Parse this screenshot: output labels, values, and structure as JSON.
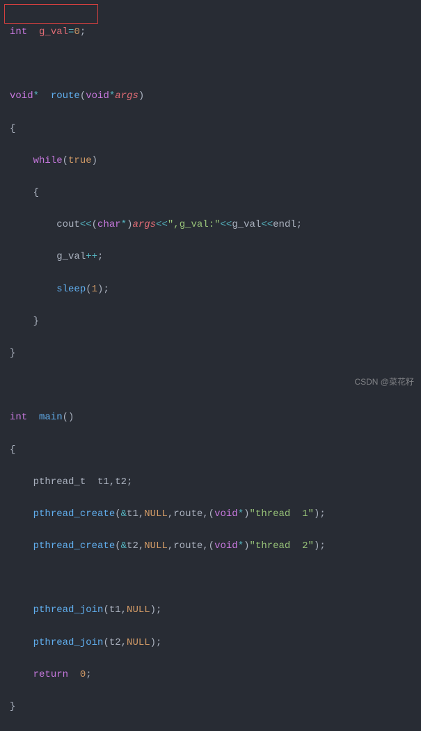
{
  "code": {
    "l1": {
      "t1": "int",
      "t2": "  g_val",
      "t3": "=",
      "t4": "0",
      "t5": ";"
    },
    "l3": {
      "t1": "void",
      "t2": "*",
      "t3": "  ",
      "t4": "route",
      "t5": "(",
      "t6": "void",
      "t7": "*",
      "t8": "args",
      "t9": ")"
    },
    "l4": {
      "t1": "{"
    },
    "l5": {
      "t1": "    ",
      "t2": "while",
      "t3": "(",
      "t4": "true",
      "t5": ")"
    },
    "l6": {
      "t1": "    {"
    },
    "l7": {
      "t1": "        cout",
      "t2": "<<",
      "t3": "(",
      "t4": "char",
      "t5": "*",
      "t6": ")",
      "t7": "args",
      "t8": "<<",
      "t9": "\",g_val:\"",
      "t10": "<<",
      "t11": "g_val",
      "t12": "<<",
      "t13": "endl;"
    },
    "l8": {
      "t1": "        g_val",
      "t2": "++",
      "t3": ";"
    },
    "l9": {
      "t1": "        ",
      "t2": "sleep",
      "t3": "(",
      "t4": "1",
      "t5": ");"
    },
    "l10": {
      "t1": "    }"
    },
    "l11": {
      "t1": "}"
    },
    "l13": {
      "t1": "int",
      "t2": "  ",
      "t3": "main",
      "t4": "()"
    },
    "l14": {
      "t1": "{"
    },
    "l15": {
      "t1": "    pthread_t  t1,t2;"
    },
    "l16": {
      "t1": "    ",
      "t2": "pthread_create",
      "t3": "(",
      "t4": "&",
      "t5": "t1,",
      "t6": "NULL",
      "t7": ",route,(",
      "t8": "void",
      "t9": "*",
      "t10": ")",
      "t11": "\"thread  1\"",
      "t12": ");"
    },
    "l17": {
      "t1": "    ",
      "t2": "pthread_create",
      "t3": "(",
      "t4": "&",
      "t5": "t2,",
      "t6": "NULL",
      "t7": ",route,(",
      "t8": "void",
      "t9": "*",
      "t10": ")",
      "t11": "\"thread  2\"",
      "t12": ");"
    },
    "l19": {
      "t1": "    ",
      "t2": "pthread_join",
      "t3": "(t1,",
      "t4": "NULL",
      "t5": ");"
    },
    "l20": {
      "t1": "    ",
      "t2": "pthread_join",
      "t3": "(t2,",
      "t4": "NULL",
      "t5": ");"
    },
    "l21": {
      "t1": "    ",
      "t2": "return",
      "t3": "  ",
      "t4": "0",
      "t5": ";"
    },
    "l22": {
      "t1": "}"
    }
  },
  "watermark": "CSDN @菜花籽"
}
